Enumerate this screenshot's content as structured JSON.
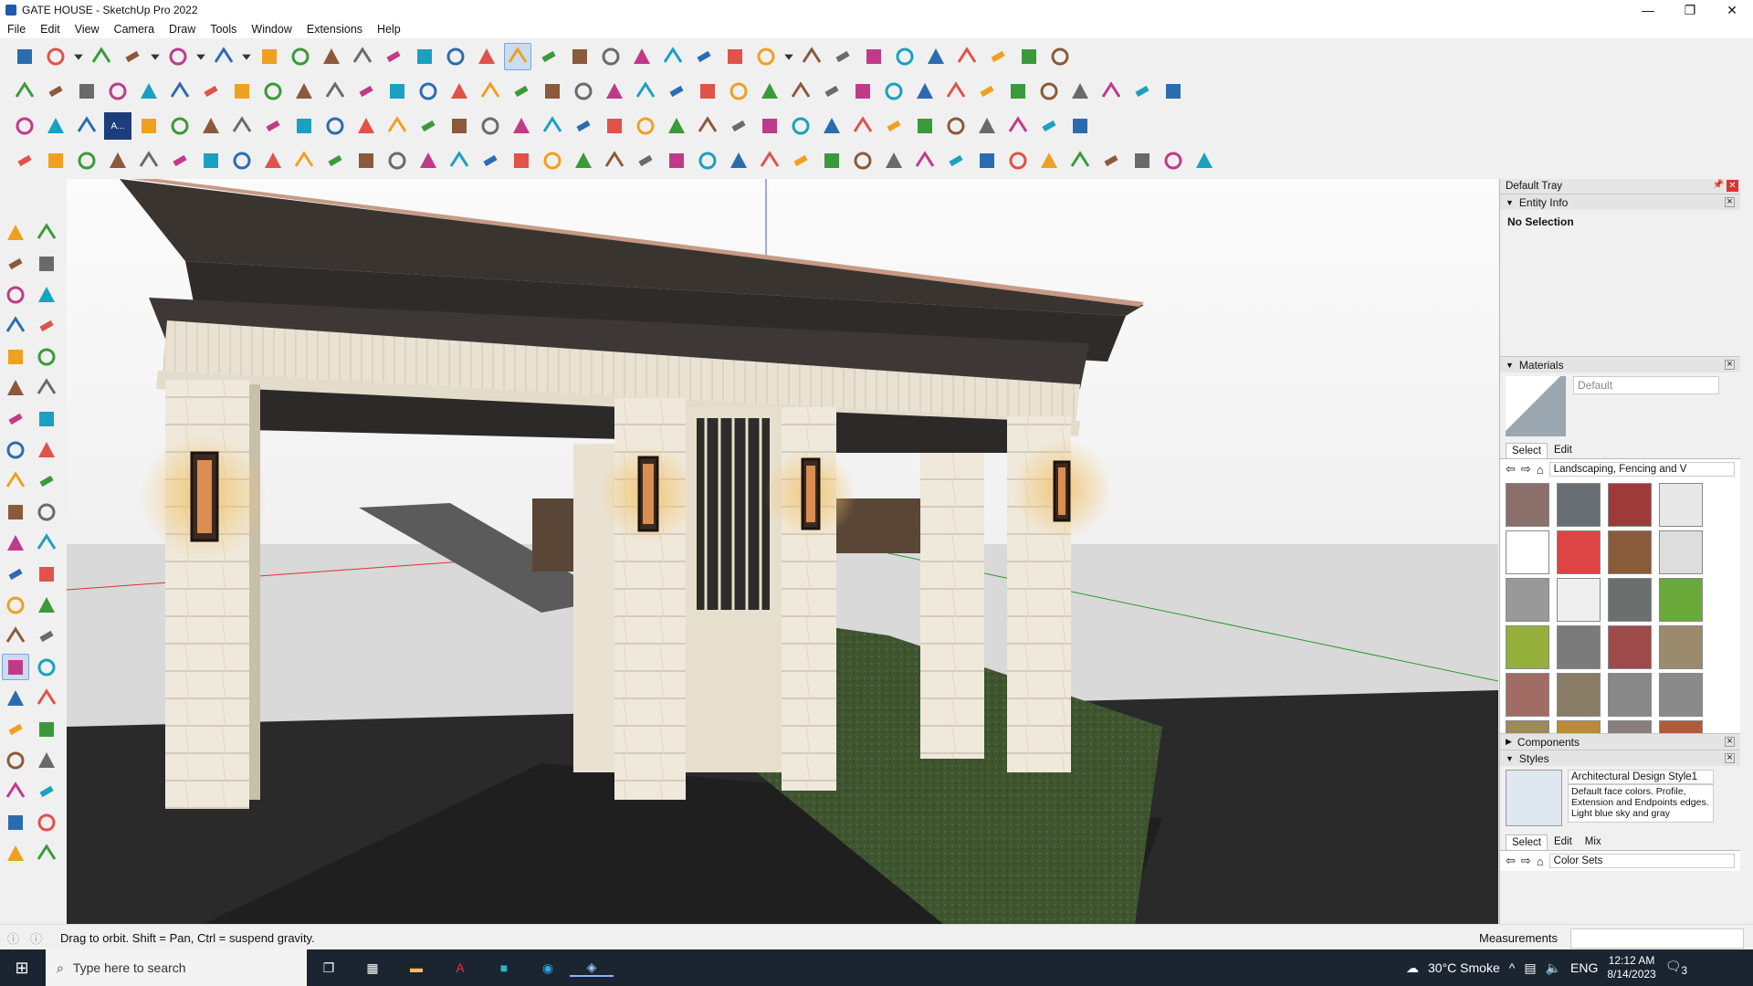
{
  "window": {
    "app_title": "GATE HOUSE - SketchUp Pro 2022",
    "minimize": "—",
    "restore": "❐",
    "close": "✕"
  },
  "menus": [
    "File",
    "Edit",
    "View",
    "Camera",
    "Draw",
    "Tools",
    "Window",
    "Extensions",
    "Help"
  ],
  "toolbars": {
    "row1": [
      "zoom-window",
      "select",
      "dropdown",
      "eraser",
      "line",
      "dropdown",
      "arc",
      "dropdown",
      "rectangle",
      "dropdown",
      "push-pull",
      "follow-me",
      "move",
      "rotate",
      "scale",
      "tape-measure",
      "text",
      "paint-bucket",
      "orbit",
      "pan",
      "zoom",
      "zoom-extents",
      "section-plane",
      "display-section-planes",
      "display-section-cuts",
      "section-fill",
      "match-photo",
      "dropdown",
      "component-1",
      "component-2",
      "axes-3d",
      "flip",
      "flip2",
      "x-ray",
      "warehouse-download",
      "warehouse-upload",
      "sun"
    ],
    "row2": [
      "iso",
      "top",
      "front",
      "right",
      "back",
      "left",
      "bottom",
      "solid-1",
      "solid-2",
      "solid-3",
      "solid-4",
      "sandbox-1",
      "sandbox-2",
      "house-1",
      "house-2",
      "house-3",
      "house-4",
      "house-5",
      "dimension",
      "paint",
      "shape-1",
      "shape-2",
      "shape-3",
      "shape-4",
      "shape-5",
      "shape-6",
      "shape-7",
      "shape-8",
      "shape-9",
      "layer-1",
      "layer-2",
      "render-1",
      "render-2",
      "render-3",
      "render-4",
      "render-5",
      "render-6",
      "render-7"
    ],
    "row3": [
      "blue-box",
      "blue-plane",
      "yellow-plane",
      "mini-label",
      "red-box",
      "orange-sphere",
      "red-sq",
      "grid-1",
      "frame",
      "wood",
      "curve",
      "grid-2",
      "red-cross",
      "green-cross",
      "blue-cross",
      "cone",
      "tent",
      "pyramid",
      "arc-yellow",
      "orange-loop",
      "spiral",
      "axes",
      "wood-2",
      "red-loop",
      "green-tree",
      "gear-1",
      "gear-2",
      "cube-red",
      "cube-2",
      "sketch-1",
      "grid-orange",
      "grid-orange-2",
      "x-red",
      "loop-2",
      "dots"
    ],
    "row4": [
      "line-tool",
      "curve-red",
      "car",
      "tool-04",
      "tool-05",
      "tool-06",
      "tool-07",
      "tool-08",
      "tool-09",
      "tool-10",
      "tool-11",
      "tool-12",
      "tool-13",
      "tool-14",
      "tool-15",
      "tool-16",
      "tool-17",
      "tool-18",
      "tool-19",
      "tool-20",
      "tool-21",
      "tool-22",
      "tool-23",
      "tool-24",
      "tool-25",
      "tool-26",
      "tool-27",
      "tool-28",
      "tool-29",
      "tool-30",
      "tool-31",
      "tool-32",
      "tool-33",
      "tool-34",
      "tool-35",
      "tool-36",
      "tool-37",
      "tool-38",
      "tool-39"
    ],
    "mini_label": "A..."
  },
  "tray": {
    "title": "Default Tray",
    "entity_info": {
      "header": "Entity Info",
      "text": "No Selection"
    },
    "materials": {
      "header": "Materials",
      "name": "Default",
      "tab_select": "Select",
      "tab_edit": "Edit",
      "collection": "Landscaping, Fencing and V",
      "swatches": [
        "#8a6f6a",
        "#686f74",
        "#9e3a3a",
        "#e8e8e8",
        "#ffffff",
        "#d44",
        "#8a5b3a",
        "#ddd",
        "#999",
        "#eee",
        "#6b6f6e",
        "#6aa83a",
        "#94b03a",
        "#7b7b7b",
        "#9e4a4a",
        "#9c8a6e",
        "#a06c64",
        "#8a7d68",
        "#888",
        "#8a8a8a",
        "#9c8a5a",
        "#b98b3b",
        "#8a7d7d",
        "#b05a3a"
      ]
    },
    "components": {
      "header": "Components"
    },
    "styles": {
      "header": "Styles",
      "name": "Architectural Design Style1",
      "description": "Default face colors. Profile, Extension and Endpoints edges. Light blue sky and gray",
      "tab_select": "Select",
      "tab_edit": "Edit",
      "tab_mix": "Mix",
      "collection": "Color Sets"
    }
  },
  "statusbar": {
    "hint": "Drag to orbit. Shift = Pan, Ctrl = suspend gravity.",
    "measurements_label": "Measurements"
  },
  "taskbar": {
    "search_placeholder": "Type here to search",
    "weather": "30°C  Smoke",
    "lang": "ENG",
    "time": "12:12 AM",
    "date": "8/14/2023",
    "notif_count": "3"
  }
}
